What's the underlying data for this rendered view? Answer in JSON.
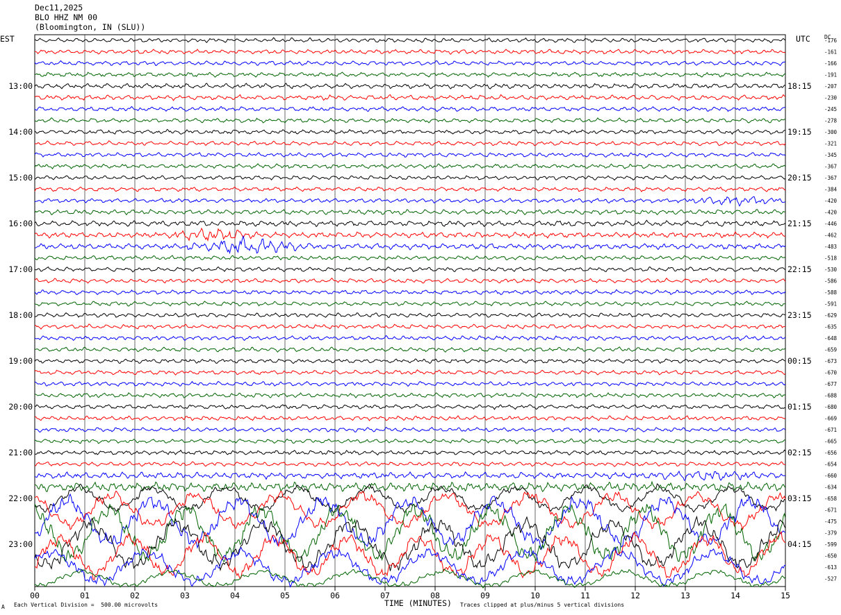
{
  "header": {
    "date": "Dec11,2025",
    "station": "BLO HHZ NM 00",
    "location": "(Bloomington, IN (SLU))"
  },
  "axes": {
    "left_tz": "EST",
    "right_tz": "UTC",
    "dc_label": "DC",
    "xlabel": "TIME (MINUTES)"
  },
  "footer": {
    "scale_note": "Each Vertical Division =  500.00 microvolts",
    "clip_note": "Traces clipped at plus/minus 5 vertical divisions",
    "corner_mark": "A"
  },
  "colors": {
    "trace_cycle": [
      "#000000",
      "#ff0000",
      "#0000ff",
      "#006400"
    ],
    "grid": "#000000"
  },
  "chart_data": {
    "type": "line",
    "title": "Dec11,2025 BLO HHZ NM 00 (Bloomington, IN (SLU))",
    "x_tick_labels": [
      "00",
      "01",
      "02",
      "03",
      "04",
      "05",
      "06",
      "07",
      "08",
      "09",
      "10",
      "11",
      "12",
      "13",
      "14",
      "15"
    ],
    "xlim": [
      0,
      15
    ],
    "traces_per_hour": 4,
    "minutes_per_trace": 15,
    "left_hour_labels": [
      {
        "row": 4,
        "text": "13:00"
      },
      {
        "row": 8,
        "text": "14:00"
      },
      {
        "row": 12,
        "text": "15:00"
      },
      {
        "row": 16,
        "text": "16:00"
      },
      {
        "row": 20,
        "text": "17:00"
      },
      {
        "row": 24,
        "text": "18:00"
      },
      {
        "row": 28,
        "text": "19:00"
      },
      {
        "row": 32,
        "text": "20:00"
      },
      {
        "row": 36,
        "text": "21:00"
      },
      {
        "row": 40,
        "text": "22:00"
      },
      {
        "row": 44,
        "text": "23:00"
      }
    ],
    "right_hour_labels": [
      {
        "row": 4,
        "text": "18:15"
      },
      {
        "row": 8,
        "text": "19:15"
      },
      {
        "row": 12,
        "text": "20:15"
      },
      {
        "row": 16,
        "text": "21:15"
      },
      {
        "row": 20,
        "text": "22:15"
      },
      {
        "row": 24,
        "text": "23:15"
      },
      {
        "row": 28,
        "text": "00:15"
      },
      {
        "row": 32,
        "text": "01:15"
      },
      {
        "row": 36,
        "text": "02:15"
      },
      {
        "row": 40,
        "text": "03:15"
      },
      {
        "row": 44,
        "text": "04:15"
      }
    ],
    "dc_offsets": [
      "-176",
      "-161",
      "-166",
      "-191",
      "-207",
      "-230",
      "-245",
      "-278",
      "-300",
      "-321",
      "-345",
      "-367",
      "-367",
      "-384",
      "-420",
      "-420",
      "-446",
      "-462",
      "-483",
      "-518",
      "-530",
      "-586",
      "-588",
      "-591",
      "-629",
      "-635",
      "-648",
      "-659",
      "-673",
      "-670",
      "-677",
      "-688",
      "-680",
      "-669",
      "-671",
      "-665",
      "-656",
      "-654",
      "-660",
      "-634",
      "-658",
      "-671",
      "-475",
      "-379",
      "-599",
      "-650",
      "-613",
      "-527"
    ],
    "trace_amplitude_divisions": [
      0.35,
      0.35,
      0.35,
      0.35,
      0.4,
      0.4,
      0.35,
      0.35,
      0.35,
      0.35,
      0.35,
      0.35,
      0.35,
      0.35,
      0.35,
      0.4,
      0.45,
      0.45,
      0.45,
      0.35,
      0.35,
      0.35,
      0.35,
      0.35,
      0.35,
      0.35,
      0.35,
      0.35,
      0.35,
      0.35,
      0.35,
      0.35,
      0.35,
      0.35,
      0.35,
      0.35,
      0.35,
      0.35,
      0.5,
      0.7,
      1.8,
      2.5,
      3.5,
      4.0,
      3.5,
      3.0,
      2.5,
      1.2
    ],
    "events": [
      {
        "row": 17,
        "start_min": 2.5,
        "end_min": 4.5,
        "peak_divisions": 1.2
      },
      {
        "row": 18,
        "start_min": 3.0,
        "end_min": 5.5,
        "peak_divisions": 1.5
      },
      {
        "row": 14,
        "start_min": 13.0,
        "end_min": 15.0,
        "peak_divisions": 0.9
      },
      {
        "row": 38,
        "start_min": 12.0,
        "end_min": 15.0,
        "peak_divisions": 1.0
      }
    ]
  }
}
